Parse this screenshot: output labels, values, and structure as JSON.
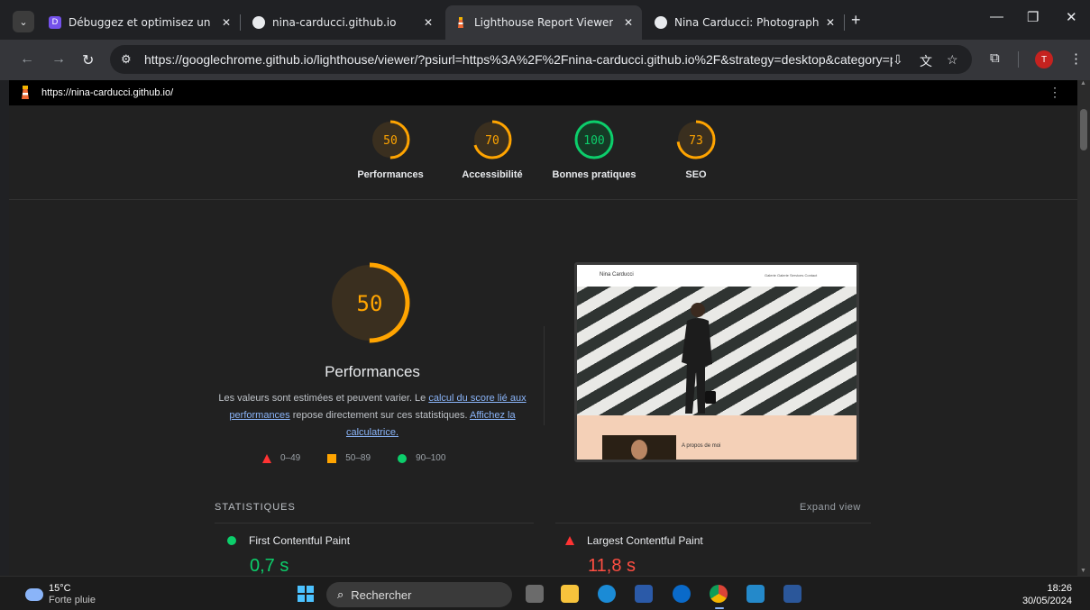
{
  "browser": {
    "tabs": [
      {
        "title": "Débuggez et optimisez un site",
        "favicon": "openclassrooms-icon"
      },
      {
        "title": "nina-carducci.github.io",
        "favicon": "globe-icon"
      },
      {
        "title": "Lighthouse Report Viewer",
        "favicon": "lighthouse-icon",
        "active": true
      },
      {
        "title": "Nina Carducci: Photographe à B",
        "favicon": "globe-icon"
      }
    ],
    "close_glyph": "✕",
    "new_tab_glyph": "+",
    "url": "https://googlechrome.github.io/lighthouse/viewer/?psiurl=https%3A%2F%2Fnina-carducci.github.io%2F&strategy=desktop&category=perfo...",
    "avatar_letter": "T"
  },
  "report": {
    "url": "https://nina-carducci.github.io/",
    "categories": [
      {
        "label": "Performances",
        "score": "50",
        "value": 50,
        "status": "average"
      },
      {
        "label": "Accessibilité",
        "score": "70",
        "value": 70,
        "status": "average"
      },
      {
        "label": "Bonnes pratiques",
        "score": "100",
        "value": 100,
        "status": "pass"
      },
      {
        "label": "SEO",
        "score": "73",
        "value": 73,
        "status": "average"
      }
    ],
    "main": {
      "score": "50",
      "value": 50,
      "title": "Performances",
      "desc_1": "Les valeurs sont estimées et peuvent varier. Le ",
      "link_1": "calcul du score lié aux performances",
      "desc_2": " repose directement sur ces statistiques. ",
      "link_2": "Affichez la calculatrice."
    },
    "legend": {
      "fail": "0–49",
      "average": "50–89",
      "pass": "90–100"
    },
    "screenshot": {
      "site_name": "Nina Carducci",
      "nav": "Galerie  Galerie  Services  Contact",
      "about": "A propos de moi"
    },
    "stats_heading": "STATISTIQUES",
    "expand_label": "Expand view",
    "metrics": [
      {
        "name": "First Contentful Paint",
        "value": "0,7 s",
        "status": "pass"
      },
      {
        "name": "Largest Contentful Paint",
        "value": "11,8 s",
        "status": "fail"
      }
    ]
  },
  "colors": {
    "pass": "#0cce6b",
    "average": "#ffa400",
    "fail": "#ff3333",
    "link": "#8ab4f8"
  },
  "taskbar": {
    "temp": "15°C",
    "weather": "Forte pluie",
    "search_label": "Rechercher",
    "time": "18:26",
    "date": "30/05/2024"
  }
}
